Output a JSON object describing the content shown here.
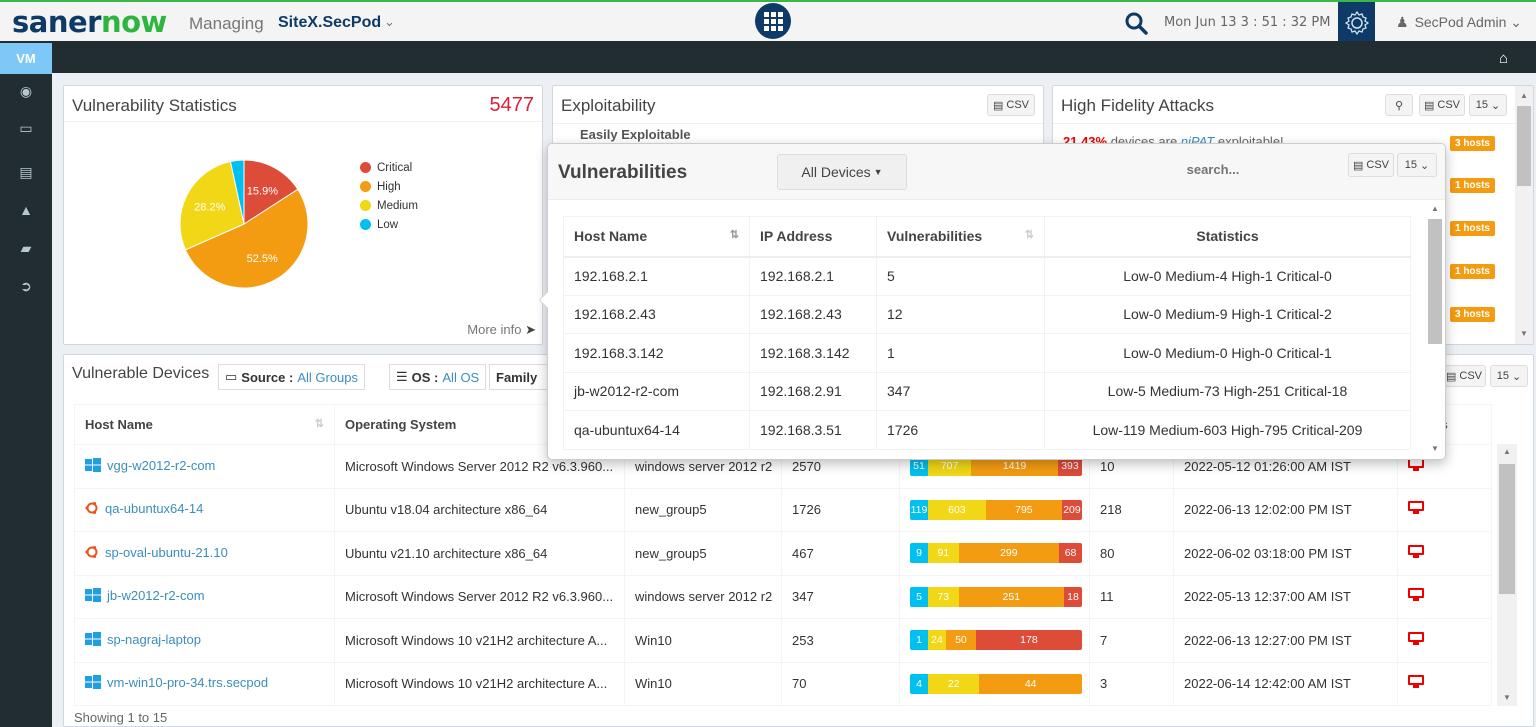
{
  "header": {
    "logo_part1": "saner",
    "logo_part2": "now",
    "managing_label": "Managing",
    "site_name": "SiteX.SecPod",
    "datetime": "Mon Jun 13  3 : 51 : 32 PM",
    "user_name": "SecPod Admin"
  },
  "nav": {
    "module": "VM",
    "sidebar_icons": [
      "eye-icon",
      "monitor-icon",
      "list-icon",
      "warning-icon",
      "book-icon",
      "sign-out-icon"
    ]
  },
  "vuln_stats": {
    "title": "Vulnerability Statistics",
    "total": "5477",
    "more_info": "More info",
    "labels": {
      "critical": "15.9%",
      "high": "52.5%",
      "medium": "28.2%"
    }
  },
  "chart_data": {
    "type": "pie",
    "title": "Vulnerability Statistics",
    "categories": [
      "Critical",
      "High",
      "Medium",
      "Low"
    ],
    "values": [
      15.9,
      52.5,
      28.2,
      3.4
    ],
    "colors": [
      "#dd4b39",
      "#f39c12",
      "#f1d716",
      "#00c0ef"
    ],
    "legend": "right"
  },
  "exploitability": {
    "title": "Exploitability",
    "csv_label": "CSV",
    "item_label": "Easily Exploitable"
  },
  "hfa": {
    "title": "High Fidelity Attacks",
    "csv_label": "CSV",
    "page_size": "15",
    "first_text_pct": "21.43%",
    "first_text_rest": " devices are ",
    "first_text_link": "niPAT",
    "first_text_end": " exploitable!",
    "badges": [
      "3 hosts",
      "1 hosts",
      "1 hosts",
      "1 hosts",
      "3 hosts"
    ]
  },
  "popup": {
    "title": "Vulnerabilities",
    "devices_dropdown": "All Devices",
    "search_placeholder": "search...",
    "csv_label": "CSV",
    "page_size": "15",
    "columns": [
      "Host Name",
      "IP Address",
      "Vulnerabilities",
      "Statistics"
    ],
    "rows": [
      {
        "host": "192.168.2.1",
        "ip": "192.168.2.1",
        "vulns": "5",
        "stats": "Low-0 Medium-4 High-1 Critical-0"
      },
      {
        "host": "192.168.2.43",
        "ip": "192.168.2.43",
        "vulns": "12",
        "stats": "Low-0 Medium-9 High-1 Critical-2"
      },
      {
        "host": "192.168.3.142",
        "ip": "192.168.3.142",
        "vulns": "1",
        "stats": "Low-0 Medium-0 High-0 Critical-1"
      },
      {
        "host": "jb-w2012-r2-com",
        "ip": "192.168.2.91",
        "vulns": "347",
        "stats": "Low-5 Medium-73 High-251 Critical-18"
      },
      {
        "host": "qa-ubuntux64-14",
        "ip": "192.168.3.51",
        "vulns": "1726",
        "stats": "Low-119 Medium-603 High-795 Critical-209"
      }
    ]
  },
  "devices": {
    "title": "Vulnerable Devices",
    "source_label": "Source :",
    "source_value": "All Groups",
    "os_label": "OS :",
    "os_value": "All OS",
    "family_label": "Family",
    "csv_label": "CSV",
    "page_size": "15",
    "columns": [
      "Host Name",
      "Operating System",
      "",
      "",
      "",
      "",
      "",
      "Status"
    ],
    "footer": "Showing 1 to 15",
    "rows": [
      {
        "os_icon": "windows",
        "host": "vgg-w2012-r2-com",
        "os": "Microsoft Windows Server 2012 R2 v6.3.960...",
        "group": "windows server 2012 r2",
        "vulns": "2570",
        "low": 51,
        "medium": 707,
        "high": 1419,
        "critical": 393,
        "col6": "10",
        "last_scan": "2022-05-12 01:26:00 AM IST"
      },
      {
        "os_icon": "ubuntu",
        "host": "qa-ubuntux64-14",
        "os": "Ubuntu v18.04 architecture x86_64",
        "group": "new_group5",
        "vulns": "1726",
        "low": 119,
        "medium": 603,
        "high": 795,
        "critical": 209,
        "col6": "218",
        "last_scan": "2022-06-13 12:02:00 PM IST"
      },
      {
        "os_icon": "ubuntu",
        "host": "sp-oval-ubuntu-21.10",
        "os": "Ubuntu v21.10 architecture x86_64",
        "group": "new_group5",
        "vulns": "467",
        "low": 9,
        "medium": 91,
        "high": 299,
        "critical": 68,
        "col6": "80",
        "last_scan": "2022-06-02 03:18:00 PM IST"
      },
      {
        "os_icon": "windows",
        "host": "jb-w2012-r2-com",
        "os": "Microsoft Windows Server 2012 R2 v6.3.960...",
        "group": "windows server 2012 r2",
        "vulns": "347",
        "low": 5,
        "medium": 73,
        "high": 251,
        "critical": 18,
        "col6": "11",
        "last_scan": "2022-05-13 12:37:00 AM IST"
      },
      {
        "os_icon": "windows",
        "host": "sp-nagraj-laptop",
        "os": "Microsoft Windows 10 v21H2 architecture A...",
        "group": "Win10",
        "vulns": "253",
        "low": 1,
        "medium": 24,
        "high": 50,
        "critical": 178,
        "col6": "7",
        "last_scan": "2022-06-13 12:27:00 PM IST"
      },
      {
        "os_icon": "windows",
        "host": "vm-win10-pro-34.trs.secpod",
        "os": "Microsoft Windows 10 v21H2 architecture A...",
        "group": "Win10",
        "vulns": "70",
        "low": 4,
        "medium": 22,
        "high": 44,
        "critical": 0,
        "col6": "3",
        "last_scan": "2022-06-14 12:42:00 AM IST"
      }
    ]
  },
  "colors": {
    "low": "#00c0ef",
    "medium": "#f1d716",
    "high": "#f39c12",
    "critical": "#dd4b39",
    "link": "#3c8dbc",
    "brand": "#0d3a66"
  }
}
